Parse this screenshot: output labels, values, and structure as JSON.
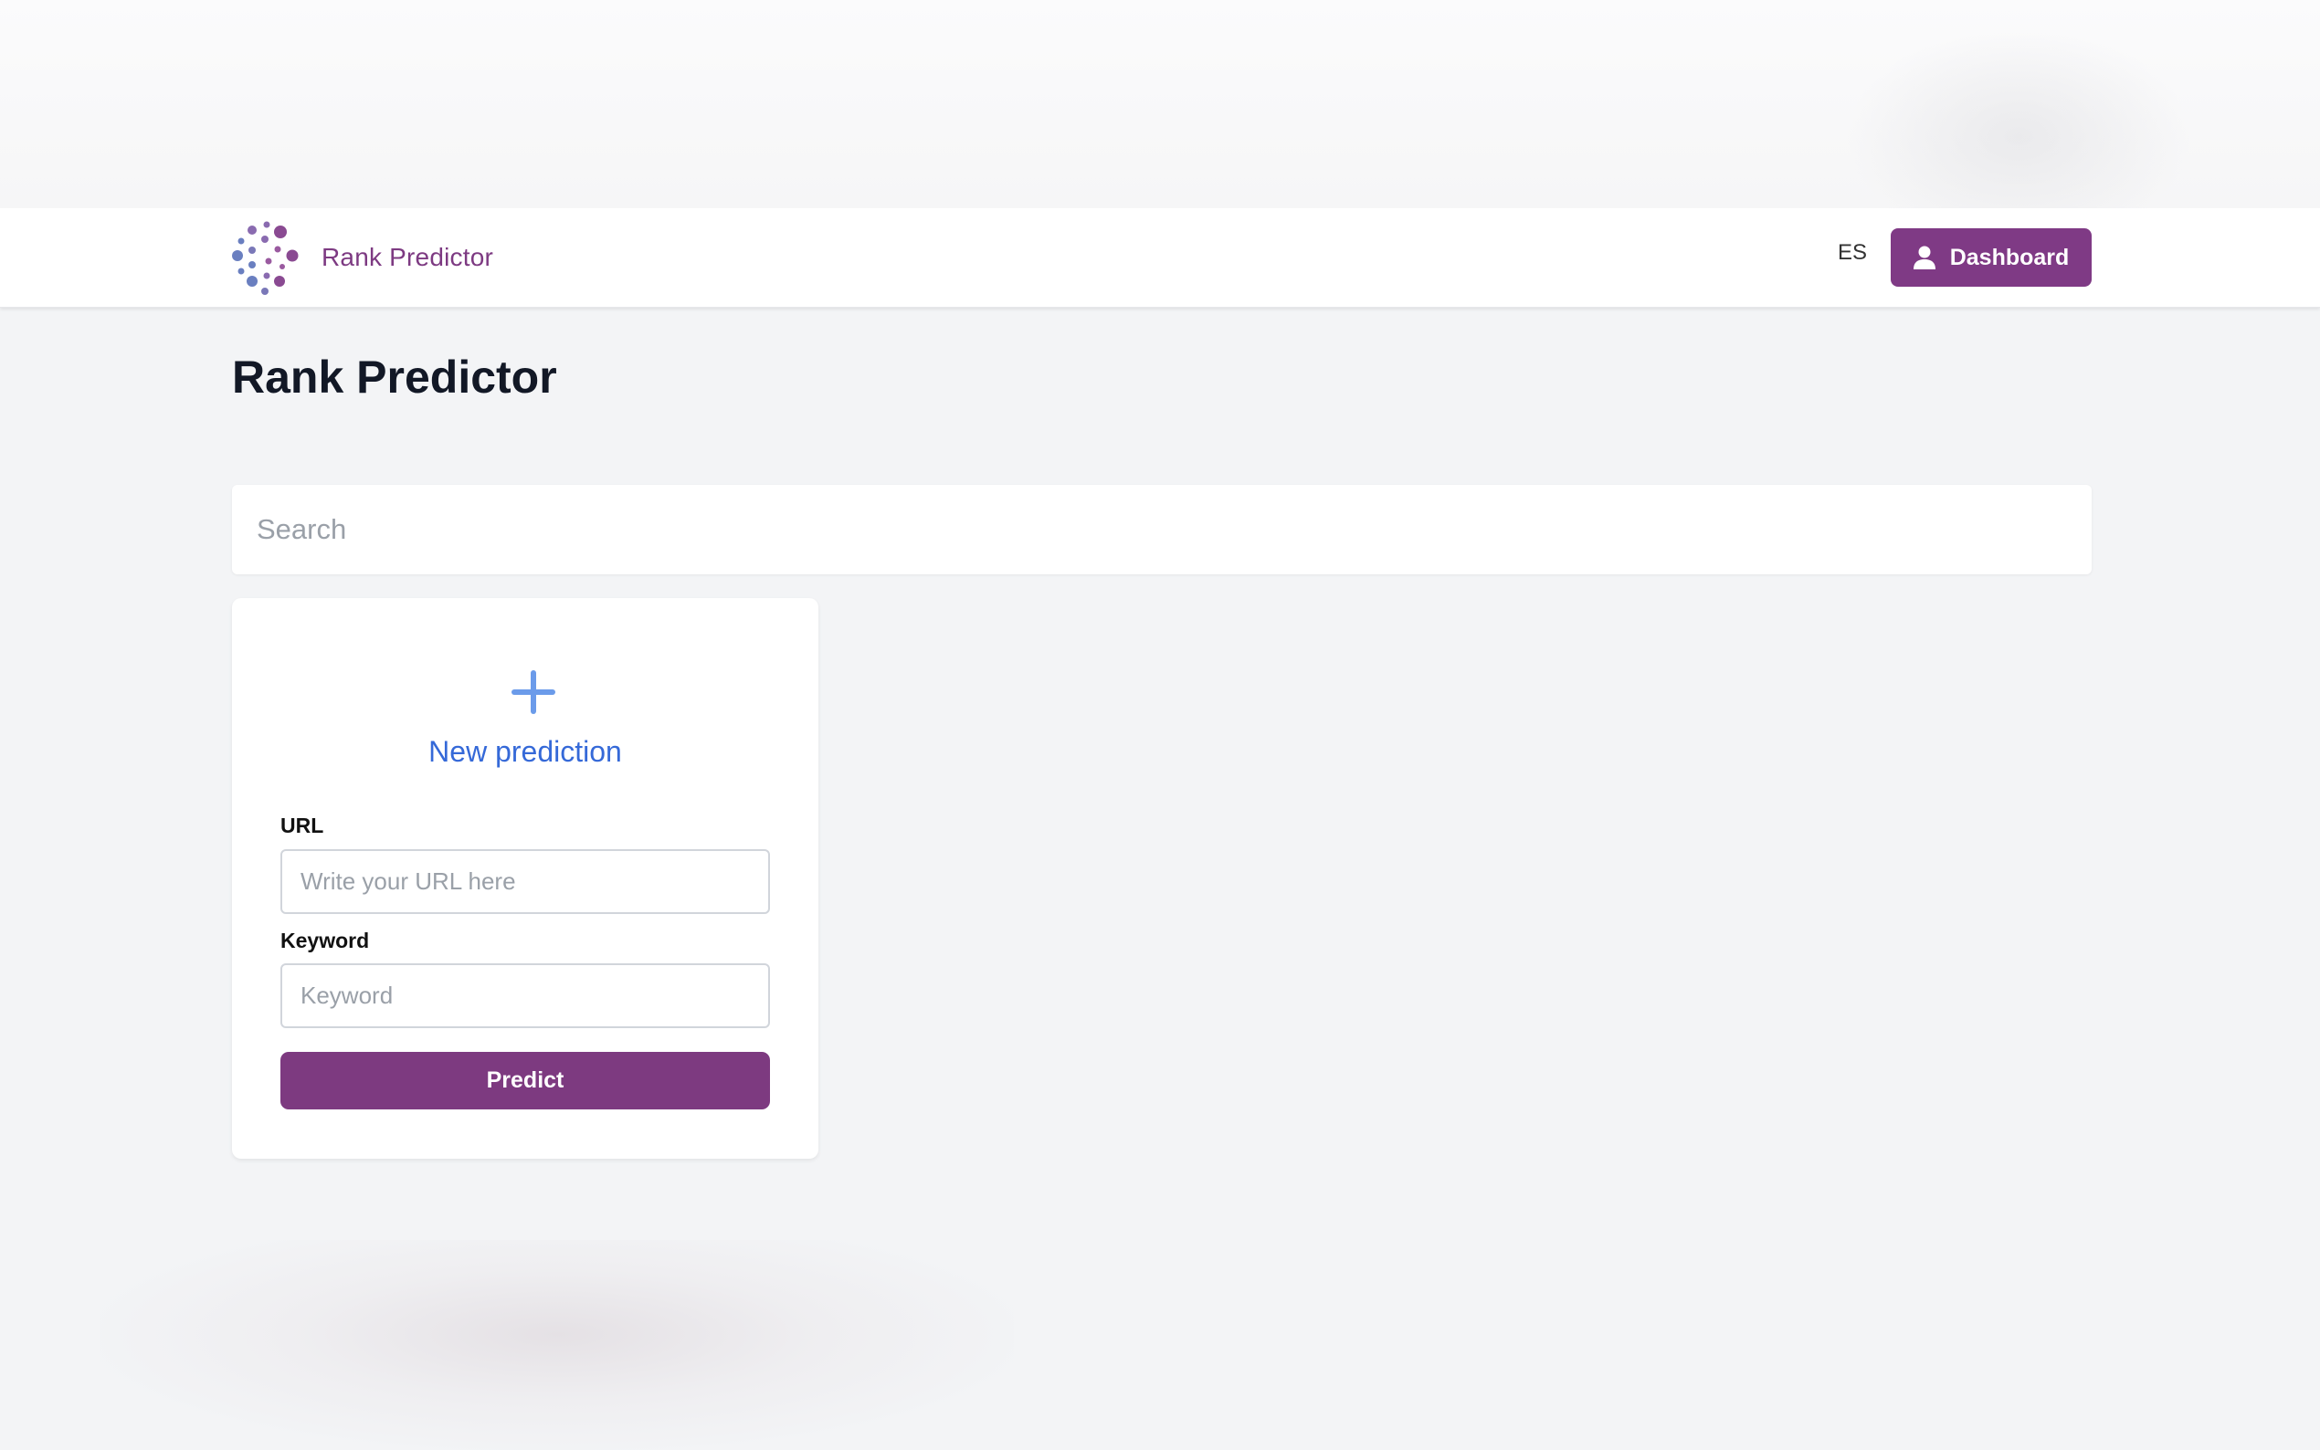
{
  "header": {
    "brand_name": "Rank Predictor",
    "language": "ES",
    "dashboard_label": "Dashboard"
  },
  "main": {
    "page_title": "Rank Predictor",
    "search_placeholder": "Search"
  },
  "new_prediction_card": {
    "title": "New prediction",
    "url_label": "URL",
    "url_placeholder": "Write your URL here",
    "keyword_label": "Keyword",
    "keyword_placeholder": "Keyword",
    "predict_label": "Predict"
  },
  "icons": [
    "logo-dots-icon",
    "user-icon",
    "plus-icon"
  ],
  "colors": {
    "brand_purple": "#7f3a85",
    "link_blue": "#3569d8",
    "plus_blue": "#6b9bea",
    "page_bg": "#f3f4f6",
    "title_text": "#121826"
  }
}
